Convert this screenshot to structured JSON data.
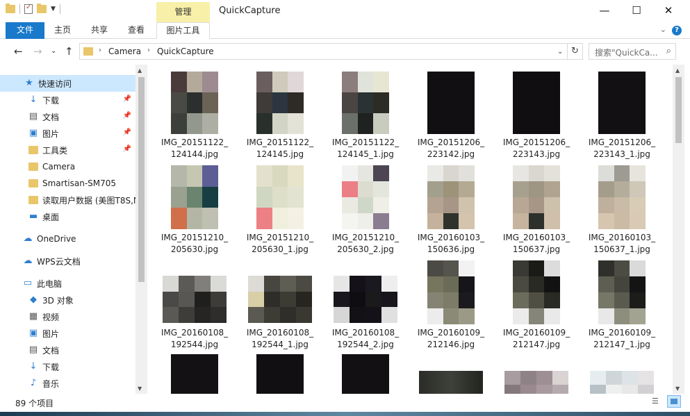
{
  "window": {
    "title": "QuickCapture",
    "manage_tab": "管理"
  },
  "ribbon": {
    "tabs": [
      {
        "label": "文件"
      },
      {
        "label": "主页"
      },
      {
        "label": "共享"
      },
      {
        "label": "查看"
      },
      {
        "label": "图片工具"
      }
    ]
  },
  "address": {
    "crumbs": [
      "Camera",
      "QuickCapture"
    ],
    "search_placeholder": "搜索\"QuickCa..."
  },
  "nav": {
    "items": [
      {
        "label": "快速访问",
        "icon": "star-icon",
        "pinned": false
      },
      {
        "label": "下载",
        "icon": "download-icon",
        "pinned": true
      },
      {
        "label": "文档",
        "icon": "document-icon",
        "pinned": true
      },
      {
        "label": "图片",
        "icon": "pictures-icon",
        "pinned": true
      },
      {
        "label": "工具类",
        "icon": "folder-icon",
        "pinned": true
      },
      {
        "label": "Camera",
        "icon": "folder-icon",
        "pinned": false
      },
      {
        "label": "Smartisan-SM705",
        "icon": "folder-icon",
        "pinned": false
      },
      {
        "label": "读取用户数据 (美图T8S,M",
        "icon": "folder-icon",
        "pinned": false
      },
      {
        "label": "桌面",
        "icon": "desktop-icon",
        "pinned": false
      },
      {
        "label": "OneDrive",
        "icon": "cloud-icon",
        "pinned": false
      },
      {
        "label": "WPS云文档",
        "icon": "cloud-outline-icon",
        "pinned": false
      },
      {
        "label": "此电脑",
        "icon": "computer-icon",
        "pinned": false
      },
      {
        "label": "3D 对象",
        "icon": "cube-icon",
        "pinned": false
      },
      {
        "label": "视频",
        "icon": "video-icon",
        "pinned": false
      },
      {
        "label": "图片",
        "icon": "pictures-icon",
        "pinned": false
      },
      {
        "label": "文档",
        "icon": "document-icon",
        "pinned": false
      },
      {
        "label": "下载",
        "icon": "download-icon",
        "pinned": false
      },
      {
        "label": "音乐",
        "icon": "music-icon",
        "pinned": false
      }
    ]
  },
  "files": [
    {
      "line1": "IMG_20151122_",
      "line2": "124144.jpg"
    },
    {
      "line1": "IMG_20151122_",
      "line2": "124145.jpg"
    },
    {
      "line1": "IMG_20151122_",
      "line2": "124145_1.jpg"
    },
    {
      "line1": "IMG_20151206_",
      "line2": "223142.jpg"
    },
    {
      "line1": "IMG_20151206_",
      "line2": "223143.jpg"
    },
    {
      "line1": "IMG_20151206_",
      "line2": "223143_1.jpg"
    },
    {
      "line1": "IMG_20151210_",
      "line2": "205630.jpg"
    },
    {
      "line1": "IMG_20151210_",
      "line2": "205630_1.jpg"
    },
    {
      "line1": "IMG_20151210_",
      "line2": "205630_2.jpg"
    },
    {
      "line1": "IMG_20160103_",
      "line2": "150636.jpg"
    },
    {
      "line1": "IMG_20160103_",
      "line2": "150637.jpg"
    },
    {
      "line1": "IMG_20160103_",
      "line2": "150637_1.jpg"
    },
    {
      "line1": "IMG_20160108_",
      "line2": "192544.jpg"
    },
    {
      "line1": "IMG_20160108_",
      "line2": "192544_1.jpg"
    },
    {
      "line1": "IMG_20160108_",
      "line2": "192544_2.jpg"
    },
    {
      "line1": "IMG_20160109_",
      "line2": "212146.jpg"
    },
    {
      "line1": "IMG_20160109_",
      "line2": "212147.jpg"
    },
    {
      "line1": "IMG_20160109_",
      "line2": "212147_1.jpg"
    },
    {
      "line1": "",
      "line2": ""
    },
    {
      "line1": "",
      "line2": ""
    },
    {
      "line1": "",
      "line2": ""
    },
    {
      "line1": "",
      "line2": ""
    },
    {
      "line1": "",
      "line2": ""
    },
    {
      "line1": "",
      "line2": ""
    }
  ],
  "status": {
    "count": "89 个项目"
  }
}
